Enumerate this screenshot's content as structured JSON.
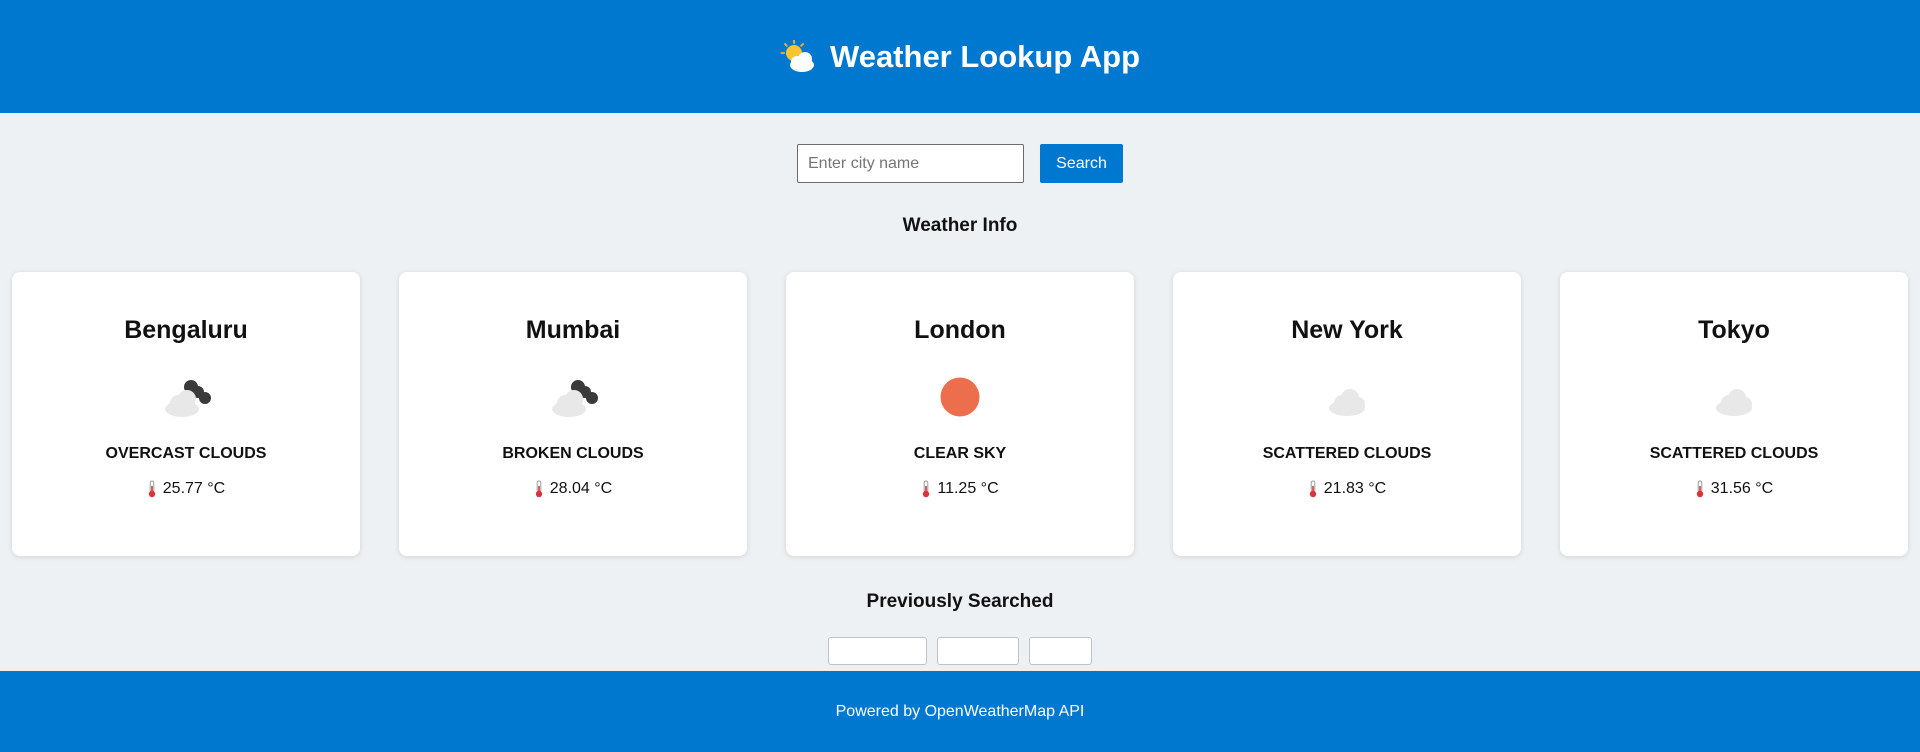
{
  "header": {
    "title": "Weather Lookup App",
    "icon": "sun-behind-cloud-icon"
  },
  "search": {
    "placeholder": "Enter city name",
    "value": "",
    "button_label": "Search"
  },
  "weather_section": {
    "title": "Weather Info"
  },
  "cards": [
    {
      "city": "Bengaluru",
      "description": "overcast clouds",
      "temperature": "25.77 °C",
      "icon": "overcast-clouds-icon"
    },
    {
      "city": "Mumbai",
      "description": "broken clouds",
      "temperature": "28.04 °C",
      "icon": "broken-clouds-icon"
    },
    {
      "city": "London",
      "description": "clear sky",
      "temperature": "11.25 °C",
      "icon": "clear-sky-icon"
    },
    {
      "city": "New York",
      "description": "scattered clouds",
      "temperature": "21.83 °C",
      "icon": "scattered-clouds-icon"
    },
    {
      "city": "Tokyo",
      "description": "scattered clouds",
      "temperature": "31.56 °C",
      "icon": "scattered-clouds-icon"
    }
  ],
  "history": {
    "title": "Previously Searched",
    "items": [
      "",
      "",
      ""
    ]
  },
  "footer": {
    "text": "Powered by OpenWeatherMap API"
  },
  "colors": {
    "primary": "#0078d0",
    "background": "#eef1f4",
    "sun": "#ec6e4c"
  }
}
